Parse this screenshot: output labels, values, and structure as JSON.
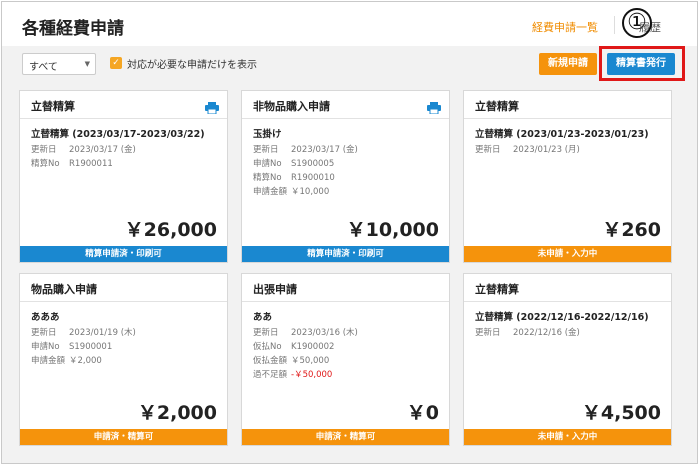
{
  "header": {
    "title": "各種経費申請",
    "link_list": "経費申請一覧",
    "link_history": "履歴",
    "marker": "①"
  },
  "toolbar": {
    "filter_value": "すべて",
    "checkbox_checked": true,
    "checkbox_label": "対応が必要な申請だけを表示",
    "new_button": "新規申請",
    "issue_button": "精算書発行"
  },
  "cards": [
    {
      "title": "立替精算",
      "printable": true,
      "subtitle": "立替精算 (2023/03/17-2023/03/22)",
      "rows": [
        {
          "label": "更新日",
          "value": "2023/03/17 (金)"
        },
        {
          "label": "精算No",
          "value": "R1900011"
        }
      ],
      "amount": "￥26,000",
      "status": "精算申請済・印刷可",
      "status_color": "#1a88d0"
    },
    {
      "title": "非物品購入申請",
      "printable": true,
      "subtitle": "玉掛け",
      "rows": [
        {
          "label": "更新日",
          "value": "2023/03/17 (金)"
        },
        {
          "label": "申請No",
          "value": "S1900005"
        },
        {
          "label": "精算No",
          "value": "R1900010"
        },
        {
          "label": "申請金額",
          "value": "￥10,000"
        }
      ],
      "amount": "￥10,000",
      "status": "精算申請済・印刷可",
      "status_color": "#1a88d0"
    },
    {
      "title": "立替精算",
      "printable": false,
      "subtitle": "立替精算 (2023/01/23-2023/01/23)",
      "rows": [
        {
          "label": "更新日",
          "value": "2023/01/23 (月)"
        }
      ],
      "amount": "￥260",
      "status": "未申請・入力中",
      "status_color": "#f5930c"
    },
    {
      "title": "物品購入申請",
      "printable": false,
      "subtitle": "あああ",
      "rows": [
        {
          "label": "更新日",
          "value": "2023/01/19 (木)"
        },
        {
          "label": "申請No",
          "value": "S1900001"
        },
        {
          "label": "申請金額",
          "value": "￥2,000"
        }
      ],
      "amount": "￥2,000",
      "status": "申請済・精算可",
      "status_color": "#f5930c"
    },
    {
      "title": "出張申請",
      "printable": false,
      "subtitle": "ああ",
      "rows": [
        {
          "label": "更新日",
          "value": "2023/03/16 (木)"
        },
        {
          "label": "仮払No",
          "value": "K1900002"
        },
        {
          "label": "仮払金額",
          "value": "￥50,000"
        },
        {
          "label": "過不足額",
          "value": "-￥50,000",
          "red": true
        }
      ],
      "amount": "￥0",
      "status": "申請済・精算可",
      "status_color": "#f5930c"
    },
    {
      "title": "立替精算",
      "printable": false,
      "subtitle": "立替精算 (2022/12/16-2022/12/16)",
      "rows": [
        {
          "label": "更新日",
          "value": "2022/12/16 (金)"
        }
      ],
      "amount": "￥4,500",
      "status": "未申請・入力中",
      "status_color": "#f5930c"
    }
  ]
}
